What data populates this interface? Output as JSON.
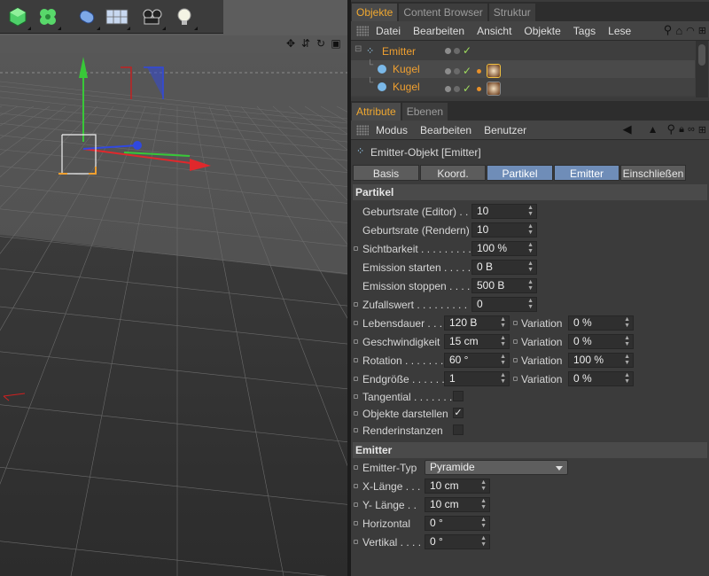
{
  "objects_tabs": [
    "Objekte",
    "Content Browser",
    "Struktur"
  ],
  "objects_menu": [
    "Datei",
    "Bearbeiten",
    "Ansicht",
    "Objekte",
    "Tags",
    "Lese"
  ],
  "object_tree": [
    {
      "name": "Emitter",
      "level": 0
    },
    {
      "name": "Kugel",
      "level": 1
    },
    {
      "name": "Kugel",
      "level": 1
    }
  ],
  "attr_tabs": [
    "Attribute",
    "Ebenen"
  ],
  "attr_menu": [
    "Modus",
    "Bearbeiten",
    "Benutzer"
  ],
  "attr_object_title": "Emitter-Objekt [Emitter]",
  "sub_tabs": [
    {
      "label": "Basis",
      "selected": false
    },
    {
      "label": "Koord.",
      "selected": false
    },
    {
      "label": "Partikel",
      "selected": true
    },
    {
      "label": "Emitter",
      "selected": true
    },
    {
      "label": "Einschließen",
      "selected": false
    }
  ],
  "partikel": {
    "title": "Partikel",
    "fields": [
      {
        "label": "Geburtsrate (Editor) . .",
        "value": "10",
        "bullet": false
      },
      {
        "label": "Geburtsrate (Rendern)",
        "value": "10",
        "bullet": false
      },
      {
        "label": "Sichtbarkeit . . . . . . . . .",
        "value": "100 %",
        "bullet": true
      },
      {
        "label": "Emission starten . . . . .",
        "value": "0 B",
        "bullet": false
      },
      {
        "label": "Emission stoppen . . . .",
        "value": "500 B",
        "bullet": false
      },
      {
        "label": "Zufallswert . . . . . . . . .",
        "value": "0",
        "bullet": true
      }
    ],
    "variation_label": "Variation",
    "var_fields": [
      {
        "label": "Lebensdauer . . .",
        "value": "120 B",
        "variation": "0 %"
      },
      {
        "label": "Geschwindigkeit",
        "value": "15 cm",
        "variation": "0 %"
      },
      {
        "label": "Rotation . . . . . . .",
        "value": "60 °",
        "variation": "100 %"
      },
      {
        "label": "Endgröße . . . . . .",
        "value": "1",
        "variation": "0 %"
      }
    ],
    "checks": [
      {
        "label": "Tangential . . . . . . .",
        "checked": false
      },
      {
        "label": "Objekte darstellen",
        "checked": true
      },
      {
        "label": "Renderinstanzen",
        "checked": false
      }
    ]
  },
  "emitter": {
    "title": "Emitter",
    "type_label": "Emitter-Typ",
    "type_value": "Pyramide",
    "fields": [
      {
        "label": "X-Länge . . .",
        "value": "10 cm"
      },
      {
        "label": "Y- Länge . .",
        "value": "10 cm"
      },
      {
        "label": "Horizontal",
        "value": "0 °"
      },
      {
        "label": "Vertikal . . . .",
        "value": "0 °"
      }
    ]
  },
  "colors": {
    "accent_orange": "#f0a830",
    "tab_selected_blue": "#6f8db8",
    "check_green": "#9fdc5e"
  },
  "icons": [
    "cube-icon",
    "cloner-icon",
    "deformer-icon",
    "floor-icon",
    "camera-icon",
    "light-icon"
  ]
}
